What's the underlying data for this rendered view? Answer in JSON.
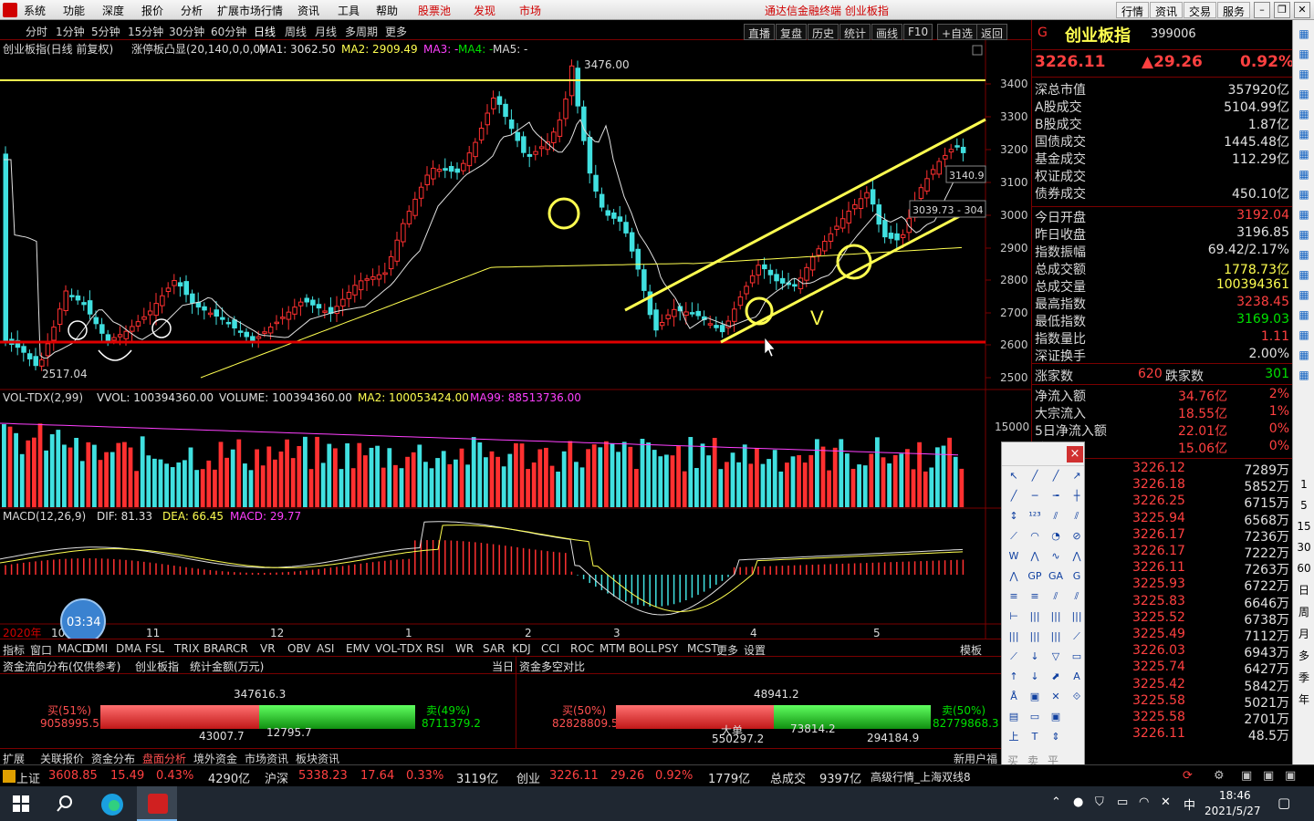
{
  "menu": {
    "items": [
      "系统",
      "功能",
      "深度",
      "报价",
      "分析",
      "扩展市场行情",
      "资讯",
      "工具",
      "帮助"
    ],
    "stock_pool": "股票池",
    "find": "发现",
    "market": "市场",
    "title": "通达信金融终端  创业板指",
    "right_buttons": [
      "行情",
      "资讯",
      "交易",
      "服务"
    ]
  },
  "periods": {
    "items": [
      "分时",
      "1分钟",
      "5分钟",
      "15分钟",
      "30分钟",
      "60分钟",
      "日线",
      "周线",
      "月线",
      "多周期",
      "更多"
    ],
    "active": "日线",
    "right": [
      "直播",
      "复盘",
      "历史",
      "统计",
      "画线",
      "F10",
      "+自选",
      "返回"
    ]
  },
  "chart": {
    "header": "创业板指(日线 前复权)",
    "indicator": "涨停板凸显(20,140,0,0,0)",
    "ma1": "MA1: 3062.50",
    "ma2": "MA2: 2909.49",
    "ma3": "MA3: -",
    "ma4": "MA4: -",
    "ma5": "MA5: -",
    "high_label": "3476.00",
    "low_label": "2517.04",
    "right_label1": "3140.9",
    "right_label2": "3039.73 - 304",
    "y_ticks": [
      "3400",
      "3300",
      "3200",
      "3100",
      "3000",
      "2900",
      "2800",
      "2700",
      "2600",
      "2500"
    ],
    "annotation": "V"
  },
  "volume": {
    "header": "VOL-TDX(2,99)",
    "vvol": "VVOL: 100394360.00",
    "volume": "VOLUME: 100394360.00",
    "ma2": "MA2: 100053424.00",
    "ma99": "MA99: 88513736.00",
    "tick": "15000"
  },
  "macd": {
    "header": "MACD(12,26,9)",
    "dif": "DIF: 81.33",
    "dea": "DEA: 66.45",
    "macd": "MACD: 29.77"
  },
  "xaxis": {
    "year": "2020年",
    "months": [
      "10",
      "11",
      "12",
      "1",
      "2",
      "3",
      "4",
      "5"
    ]
  },
  "timer": "03:34",
  "indicator_tabs": [
    "指标",
    "窗口",
    "MACD",
    "DMI",
    "DMA",
    "FSL",
    "TRIX",
    "BRAR",
    "CR",
    "VR",
    "OBV",
    "ASI",
    "EMV",
    "VOL-TDX",
    "RSI",
    "WR",
    "SAR",
    "KDJ",
    "CCI",
    "ROC",
    "MTM",
    "BOLL",
    "PSY",
    "MCST",
    "更多",
    "设置"
  ],
  "template_btn": "模板",
  "flow": {
    "title": "资金流向分布(仅供参考)",
    "name": "创业板指",
    "stat": "统计金额(万元)",
    "today": "当日",
    "compare": "资金多空对比",
    "left_top": "347616.3",
    "left_buy_label": "买(51%)",
    "left_buy": "9058995.5",
    "left_sell_label": "卖(49%)",
    "left_sell": "8711379.2",
    "left_sub1": "43007.7",
    "left_sub2": "12795.7",
    "right_top": "48941.2",
    "right_buy_label": "买(50%)",
    "right_buy": "82828809.5",
    "right_sell_label": "卖(50%)",
    "right_sell": "82779868.3",
    "right_sub1": "大单",
    "right_sub2": "73814.2",
    "right_sub3": "550297.2",
    "right_sub4": "294184.9"
  },
  "func_tabs": [
    "扩展",
    "关联报价",
    "资金分布",
    "盘面分析",
    "境外资金",
    "市场资讯",
    "板块资讯"
  ],
  "func_right": "新用户福",
  "quote": {
    "code_letter": "G",
    "name": "创业板指",
    "code": "399006",
    "price": "3226.11",
    "change": "▲29.26",
    "pct": "0.92%",
    "rows": [
      [
        "深总市值",
        "357920亿"
      ],
      [
        "A股成交",
        "5104.99亿"
      ],
      [
        "B股成交",
        "1.87亿"
      ],
      [
        "国债成交",
        "1445.48亿"
      ],
      [
        "基金成交",
        "112.29亿"
      ],
      [
        "权证成交",
        ""
      ],
      [
        "债券成交",
        "450.10亿"
      ]
    ],
    "rows2": [
      [
        "今日开盘",
        "3192.04"
      ],
      [
        "昨日收盘",
        "3196.85"
      ],
      [
        "指数振幅",
        "69.42/2.17%"
      ],
      [
        "总成交额",
        "1778.73亿"
      ],
      [
        "总成交量",
        "100394361"
      ],
      [
        "最高指数",
        "3238.45"
      ],
      [
        "最低指数",
        "3169.03"
      ],
      [
        "指数量比",
        "1.11"
      ],
      [
        "深证换手",
        "2.00%"
      ]
    ],
    "updown": {
      "up_label": "涨家数",
      "up": "620",
      "down_label": "跌家数",
      "down": "301"
    },
    "flows": [
      [
        "净流入额",
        "34.76亿",
        "2%"
      ],
      [
        "大宗流入",
        "18.55亿",
        "1%"
      ],
      [
        "5日净流入额",
        "22.01亿",
        "0%"
      ],
      [
        "流入",
        "15.06亿",
        "0%"
      ]
    ],
    "ticks": [
      [
        "3226.12",
        "7289万"
      ],
      [
        "3226.18",
        "5852万"
      ],
      [
        "3226.25",
        "6715万"
      ],
      [
        "3225.94",
        "6568万"
      ],
      [
        "3226.17",
        "7236万"
      ],
      [
        "3226.17",
        "7222万"
      ],
      [
        "3226.11",
        "7263万"
      ],
      [
        "3225.93",
        "6722万"
      ],
      [
        "3225.83",
        "6646万"
      ],
      [
        "3225.52",
        "6738万"
      ],
      [
        "3225.49",
        "7112万"
      ],
      [
        "3226.03",
        "6943万"
      ],
      [
        "3225.74",
        "6427万"
      ],
      [
        "3225.42",
        "5842万"
      ],
      [
        "3225.58",
        "5021万"
      ],
      [
        "3225.58",
        "2701万"
      ],
      [
        "3226.11",
        "48.5万"
      ]
    ]
  },
  "side_icons": [
    "日",
    "周",
    "月",
    "多",
    "季",
    "年"
  ],
  "side_nums": [
    "1",
    "5",
    "15",
    "30",
    "60"
  ],
  "ticker": {
    "sh_name": "上证",
    "sh": "3608.85",
    "sh_chg": "15.49",
    "sh_pct": "0.43%",
    "sh_amt": "4290亿",
    "hs_name": "沪深",
    "hs": "5338.23",
    "hs_chg": "17.64",
    "hs_pct": "0.33%",
    "hs_amt": "3119亿",
    "cy_name": "创业",
    "cy": "3226.11",
    "cy_chg": "29.26",
    "cy_pct": "0.92%",
    "cy_amt": "1779亿",
    "total_label": "总成交",
    "total": "9397亿",
    "feed": "高级行情_上海双线8"
  },
  "taskbar": {
    "time": "18:46",
    "date": "2021/5/27",
    "ime": "中"
  },
  "drawtool": {
    "close": "×",
    "bottom": [
      "买",
      "卖",
      "平"
    ]
  }
}
